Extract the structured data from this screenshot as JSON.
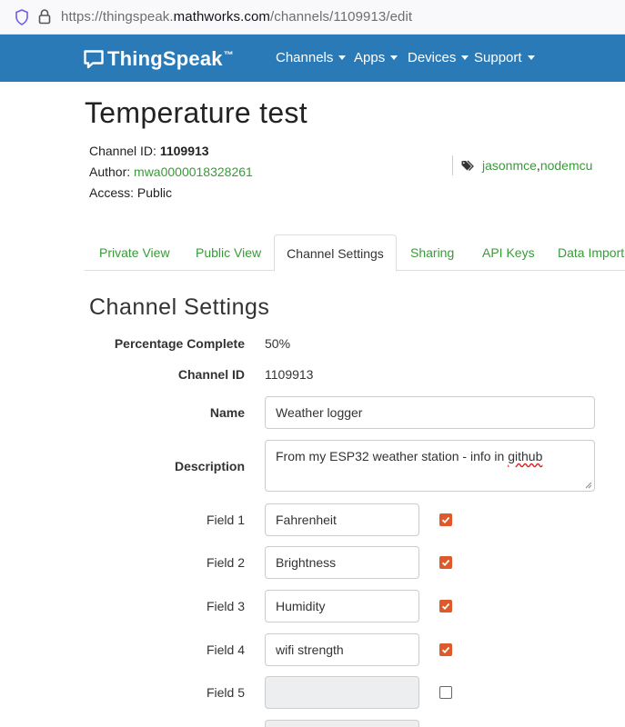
{
  "browser": {
    "url_prefix": "https://thingspeak.",
    "url_host": "mathworks.com",
    "url_path": "/channels/1109913/edit",
    "shield_icon": "shield-icon",
    "lock_icon": "lock-icon"
  },
  "navbar": {
    "brand": "ThingSpeak",
    "trademark": "™",
    "logo_icon": "speech-bubble-icon",
    "bg_color": "#2a7ab8",
    "items": [
      {
        "label": "Channels"
      },
      {
        "label": "Apps"
      },
      {
        "label": "Devices"
      },
      {
        "label": "Support"
      }
    ]
  },
  "channel": {
    "title": "Temperature test",
    "id_label": "Channel ID: ",
    "id_value": "1109913",
    "author_label": "Author: ",
    "author_value": "mwa0000018328261",
    "access_label": "Access: ",
    "access_value": "Public",
    "tags": [
      "jasonmce",
      "nodemcu"
    ],
    "tag_separator": ", ",
    "tag_icon": "tags-icon",
    "link_color": "#3a9a3a"
  },
  "tabs": [
    {
      "label": "Private View",
      "active": false
    },
    {
      "label": "Public View",
      "active": false
    },
    {
      "label": "Channel Settings",
      "active": true
    },
    {
      "label": "Sharing",
      "active": false
    },
    {
      "label": "API Keys",
      "active": false
    },
    {
      "label": "Data Import",
      "active": false
    }
  ],
  "settings": {
    "section_title": "Channel Settings",
    "percentage_label": "Percentage Complete",
    "percentage_value": "50%",
    "channel_id_label": "Channel ID",
    "channel_id_value": "1109913",
    "name_label": "Name",
    "name_value": "Weather logger",
    "description_label": "Description",
    "description_value_main": "From my ESP32 weather station - info in ",
    "description_value_misspelled": "github",
    "checkbox_color": "#e0592a",
    "fields": [
      {
        "label": "Field 1",
        "value": "Fahrenheit",
        "enabled": true
      },
      {
        "label": "Field 2",
        "value": "Brightness",
        "enabled": true
      },
      {
        "label": "Field 3",
        "value": "Humidity",
        "enabled": true
      },
      {
        "label": "Field 4",
        "value": "wifi strength",
        "enabled": true
      },
      {
        "label": "Field 5",
        "value": "",
        "enabled": false
      }
    ]
  }
}
